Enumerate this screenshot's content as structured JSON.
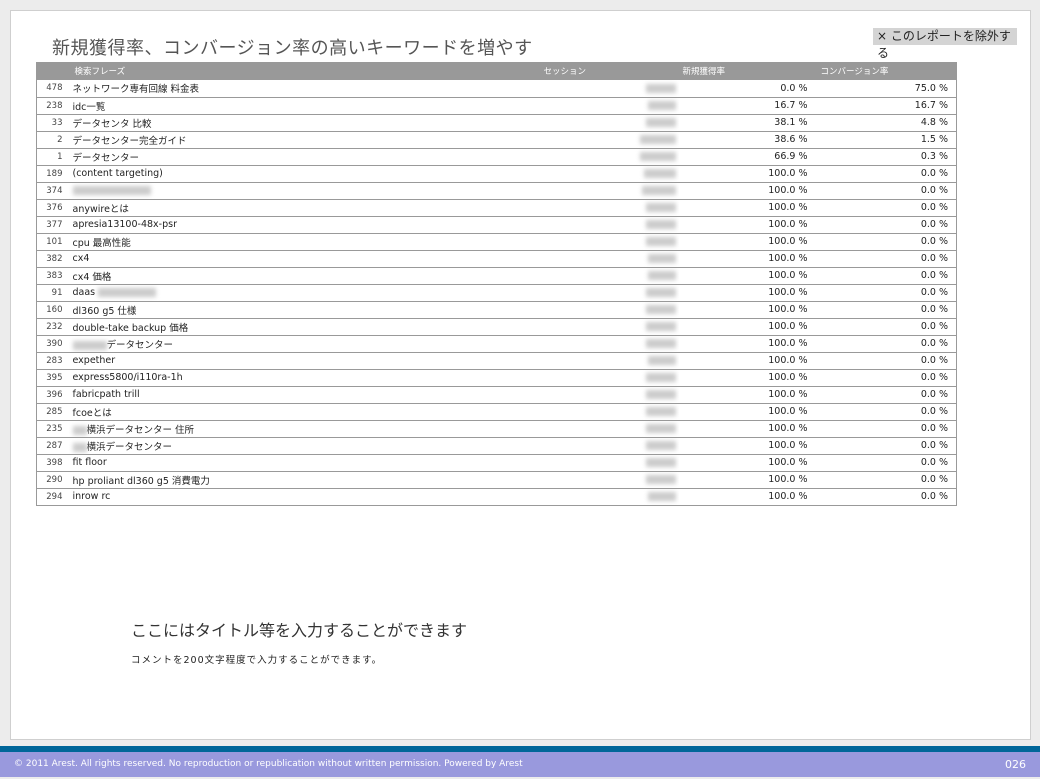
{
  "title": "新規獲得率、コンバージョン率の高いキーワードを増やす",
  "exclude_button": "× このレポートを除外する",
  "table": {
    "headers": [
      "",
      "検索フレーズ",
      "セッション",
      "新規獲得率",
      "コンバージョン率"
    ],
    "rows": [
      {
        "idx": "478",
        "keyword": "ネットワーク専有回線 料金表",
        "new": "0.0 %",
        "conv": "75.0 %"
      },
      {
        "idx": "238",
        "keyword": "idc一覧",
        "new": "16.7 %",
        "conv": "16.7 %"
      },
      {
        "idx": "33",
        "keyword": "データセンタ 比較",
        "new": "38.1 %",
        "conv": "4.8 %"
      },
      {
        "idx": "2",
        "keyword": "データセンター完全ガイド",
        "new": "38.6 %",
        "conv": "1.5 %"
      },
      {
        "idx": "1",
        "keyword": "データセンター",
        "new": "66.9 %",
        "conv": "0.3 %"
      },
      {
        "idx": "189",
        "keyword": "(content targeting)",
        "new": "100.0 %",
        "conv": "0.0 %"
      },
      {
        "idx": "374",
        "keyword": "",
        "blur": "full",
        "new": "100.0 %",
        "conv": "0.0 %"
      },
      {
        "idx": "376",
        "keyword": "anywireとは",
        "new": "100.0 %",
        "conv": "0.0 %"
      },
      {
        "idx": "377",
        "keyword": "apresia13100-48x-psr",
        "new": "100.0 %",
        "conv": "0.0 %"
      },
      {
        "idx": "101",
        "keyword": "cpu 最高性能",
        "new": "100.0 %",
        "conv": "0.0 %"
      },
      {
        "idx": "382",
        "keyword": "cx4",
        "new": "100.0 %",
        "conv": "0.0 %"
      },
      {
        "idx": "383",
        "keyword": "cx4 価格",
        "new": "100.0 %",
        "conv": "0.0 %"
      },
      {
        "idx": "91",
        "keyword": "daas",
        "blur": "suffix",
        "new": "100.0 %",
        "conv": "0.0 %"
      },
      {
        "idx": "160",
        "keyword": "dl360 g5 仕様",
        "new": "100.0 %",
        "conv": "0.0 %"
      },
      {
        "idx": "232",
        "keyword": "double-take backup 価格",
        "new": "100.0 %",
        "conv": "0.0 %"
      },
      {
        "idx": "390",
        "keyword": "データセンター",
        "blur": "prefix",
        "new": "100.0 %",
        "conv": "0.0 %"
      },
      {
        "idx": "283",
        "keyword": "expether",
        "new": "100.0 %",
        "conv": "0.0 %"
      },
      {
        "idx": "395",
        "keyword": "express5800/i110ra-1h",
        "new": "100.0 %",
        "conv": "0.0 %"
      },
      {
        "idx": "396",
        "keyword": "fabricpath trill",
        "new": "100.0 %",
        "conv": "0.0 %"
      },
      {
        "idx": "285",
        "keyword": "fcoeとは",
        "new": "100.0 %",
        "conv": "0.0 %"
      },
      {
        "idx": "235",
        "keyword": "横浜データセンター 住所",
        "blur": "prefix-short",
        "new": "100.0 %",
        "conv": "0.0 %"
      },
      {
        "idx": "287",
        "keyword": "横浜データセンター",
        "blur": "prefix-short",
        "new": "100.0 %",
        "conv": "0.0 %"
      },
      {
        "idx": "398",
        "keyword": "fit floor",
        "new": "100.0 %",
        "conv": "0.0 %"
      },
      {
        "idx": "290",
        "keyword": "hp proliant dl360 g5 消費電力",
        "new": "100.0 %",
        "conv": "0.0 %"
      },
      {
        "idx": "294",
        "keyword": "inrow rc",
        "new": "100.0 %",
        "conv": "0.0 %"
      }
    ]
  },
  "comment": {
    "title": "ここにはタイトル等を入力することができます",
    "body": "コメントを200文字程度で入力することができます。"
  },
  "footer": {
    "copyright": "© 2011 Arest. All rights reserved. No reproduction or republication without written permission. Powered by Arest",
    "page": "026"
  },
  "colors": {
    "header_bg": "#999999",
    "band": "#006699",
    "footer": "#9999dd"
  }
}
